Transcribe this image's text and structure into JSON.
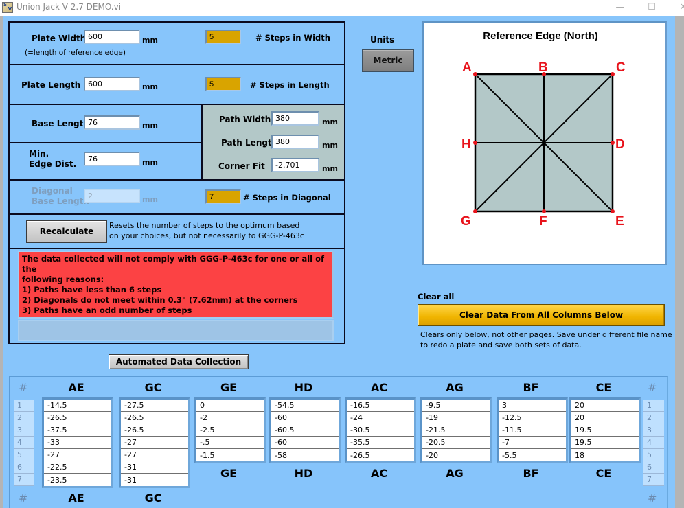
{
  "window": {
    "title": "Union Jack V 2.7 DEMO.vi",
    "icon": "labview-vi-icon",
    "icon_letters": [
      "S",
      "V"
    ],
    "controls": {
      "minimize": "—",
      "maximize": "☐",
      "close": "✕"
    }
  },
  "settings": {
    "plate_width": {
      "label": "Plate Width",
      "value": "600",
      "unit": "mm",
      "note": "(=length of reference edge)"
    },
    "steps_width": {
      "value": "5",
      "label": "# Steps in Width"
    },
    "plate_length": {
      "label": "Plate Length",
      "value": "600",
      "unit": "mm"
    },
    "steps_length": {
      "value": "5",
      "label": "# Steps in Length"
    },
    "base_length": {
      "label": "Base Length",
      "value": "76",
      "unit": "mm"
    },
    "min_edge_dist": {
      "label_line1": "Min.",
      "label_line2": "Edge Dist.",
      "value": "76",
      "unit": "mm"
    },
    "path_width": {
      "label": "Path Width",
      "value": "380",
      "unit": "mm"
    },
    "path_length": {
      "label": "Path Length",
      "value": "380",
      "unit": "mm"
    },
    "corner_fit": {
      "label": "Corner Fit",
      "value": "-2.701",
      "unit": "mm"
    },
    "diagonal_base_length": {
      "label_line1": "Diagonal",
      "label_line2": "Base Length",
      "value": "2",
      "unit": "mm"
    },
    "steps_diagonal": {
      "value": "7",
      "label": "# Steps in Diagonal"
    },
    "recalculate": {
      "label": "Recalculate",
      "description_line1": "Resets the number of steps to the optimum based",
      "description_line2": "on your choices, but not necessarily to GGG-P-463c"
    }
  },
  "warning": {
    "lines": [
      "The data collected will not comply with GGG-P-463c for one or all of the",
      "following reasons:",
      "1) Paths have less than 6 steps",
      "2) Diagonals do not meet within 0.3\" (7.62mm) at the corners",
      "3) Paths have an odd number of steps"
    ],
    "color": "#fc4244"
  },
  "units": {
    "label": "Units",
    "button": "Metric"
  },
  "diagram": {
    "title": "Reference Edge (North)",
    "points": [
      "A",
      "B",
      "C",
      "D",
      "E",
      "F",
      "G",
      "H"
    ],
    "label_color": "#e8141c",
    "fill_color": "#b3c8c8"
  },
  "automated_button": "Automated Data Collection",
  "clear": {
    "section_label": "Clear all",
    "button": "Clear Data From All Columns Below",
    "note_line1": "Clears only below, not other pages.  Save under different file name",
    "note_line2": "to redo a plate and save both sets of data."
  },
  "table": {
    "hash": "#",
    "row_indices": [
      "1",
      "2",
      "3",
      "4",
      "5",
      "6",
      "7"
    ],
    "columns": [
      {
        "name": "AE",
        "values": [
          "-14.5",
          "-26.5",
          "-37.5",
          "-33",
          "-27",
          "-22.5",
          "-23.5"
        ]
      },
      {
        "name": "GC",
        "values": [
          "-27.5",
          "-26.5",
          "-26.5",
          "-27",
          "-27",
          "-31",
          "-31"
        ]
      },
      {
        "name": "GE",
        "values": [
          "0",
          "-2",
          "-2.5",
          "-.5",
          "-1.5"
        ]
      },
      {
        "name": "HD",
        "values": [
          "-54.5",
          "-60",
          "-60.5",
          "-60",
          "-58"
        ]
      },
      {
        "name": "AC",
        "values": [
          "-16.5",
          "-24",
          "-30.5",
          "-35.5",
          "-26.5"
        ]
      },
      {
        "name": "AG",
        "values": [
          "-9.5",
          "-19",
          "-21.5",
          "-20.5",
          "-20"
        ]
      },
      {
        "name": "BF",
        "values": [
          "3",
          "-12.5",
          "-11.5",
          "-7",
          "-5.5"
        ]
      },
      {
        "name": "CE",
        "values": [
          "20",
          "20",
          "19.5",
          "19.5",
          "18"
        ]
      }
    ]
  }
}
